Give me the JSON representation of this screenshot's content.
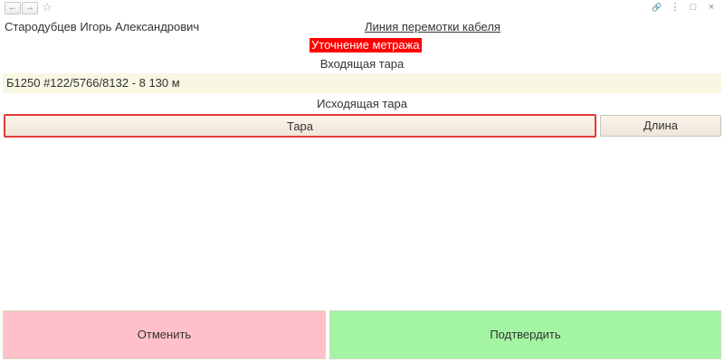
{
  "toolbar": {
    "back_glyph": "←",
    "forward_glyph": "→",
    "star_glyph": "☆",
    "link_glyph": "🔗",
    "menu_glyph": "⋮",
    "maximize_glyph": "□",
    "close_glyph": "×"
  },
  "header": {
    "user_name": "Стародубцев Игорь Александрович",
    "line_title": "Линия перемотки кабеля"
  },
  "refine_label": "Уточнение метража",
  "incoming": {
    "label": "Входящая тара",
    "value": "Б1250 #122/5766/8132 - 8 130 м"
  },
  "outgoing": {
    "label": "Исходящая тара",
    "tara_button": "Тара",
    "length_button": "Длина"
  },
  "actions": {
    "cancel": "Отменить",
    "confirm": "Подтвердить"
  },
  "colors": {
    "refine_bg": "#ff0000",
    "cancel_bg": "#ffc0cb",
    "confirm_bg": "#a3f5a3",
    "field_bg": "#f7f7e3",
    "selected_border": "#e23a3a"
  }
}
